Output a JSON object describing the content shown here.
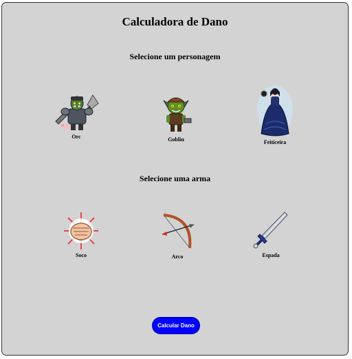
{
  "title": "Calculadora de Dano",
  "characters": {
    "label": "Selecione um personagem",
    "items": [
      {
        "name": "Orc",
        "icon": "orc-warrior-icon"
      },
      {
        "name": "Goblin",
        "icon": "goblin-icon"
      },
      {
        "name": "Feiticeira",
        "icon": "sorceress-icon"
      }
    ]
  },
  "weapons": {
    "label": "Selecione uma arma",
    "items": [
      {
        "name": "Soco",
        "icon": "fist-punch-icon"
      },
      {
        "name": "Arco",
        "icon": "bow-arrow-icon"
      },
      {
        "name": "Espada",
        "icon": "sword-icon"
      }
    ]
  },
  "button": {
    "label": "Calcular Dano",
    "color": "#0000ff"
  },
  "colors": {
    "panel_bg": "#d3d3d3",
    "panel_border": "#333333"
  }
}
